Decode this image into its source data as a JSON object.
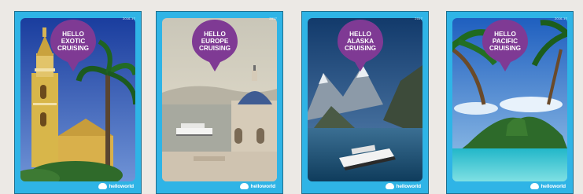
{
  "brochures": [
    {
      "title_lines": [
        "HELLO",
        "EXOTIC",
        "CRUISING"
      ],
      "year": "2016-17",
      "brand": "helloworld"
    },
    {
      "title_lines": [
        "HELLO",
        "EUROPE",
        "CRUISING"
      ],
      "year": "2017",
      "brand": "helloworld"
    },
    {
      "title_lines": [
        "HELLO",
        "ALASKA",
        "CRUISING"
      ],
      "year": "2017",
      "brand": "helloworld"
    },
    {
      "title_lines": [
        "HELLO",
        "PACIFIC",
        "CRUISING"
      ],
      "year": "2016-17",
      "brand": "helloworld"
    }
  ],
  "colors": {
    "background": "#ece9e5",
    "cover_border": "#2fb4e6",
    "pin": "#7f3a94"
  }
}
